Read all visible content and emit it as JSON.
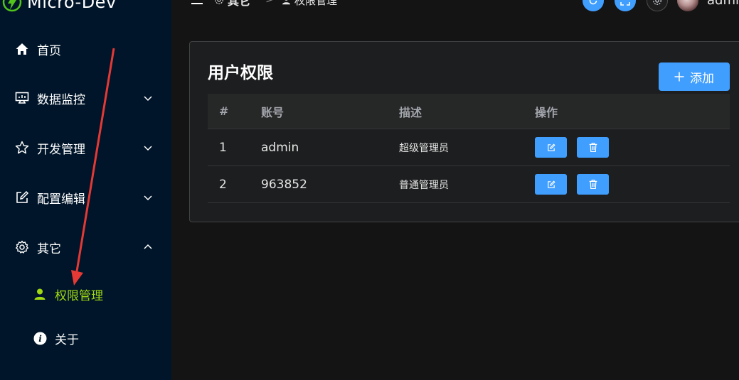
{
  "app": {
    "title": "Micro-Dev"
  },
  "sidebar": {
    "items": [
      {
        "label": "首页",
        "icon": "home-icon"
      },
      {
        "label": "数据监控",
        "icon": "monitor-icon"
      },
      {
        "label": "开发管理",
        "icon": "star-icon"
      },
      {
        "label": "配置编辑",
        "icon": "edit-icon"
      },
      {
        "label": "其它",
        "icon": "gear-icon"
      }
    ],
    "subitems": [
      {
        "label": "权限管理",
        "icon": "user-icon",
        "active": true
      },
      {
        "label": "关于",
        "icon": "info-icon"
      }
    ]
  },
  "header": {
    "breadcrumb": [
      "其它",
      "权限管理"
    ],
    "username": "admin"
  },
  "card": {
    "title": "用户权限",
    "add_label": "添加"
  },
  "table": {
    "columns": [
      "#",
      "账号",
      "描述",
      "操作"
    ],
    "rows": [
      {
        "num": "1",
        "account": "admin",
        "desc": "超级管理员"
      },
      {
        "num": "2",
        "account": "963852",
        "desc": "普通管理员"
      }
    ]
  },
  "colors": {
    "sidebar_bg": "#001529",
    "accent": "#409eff",
    "active": "#a0d911",
    "annotation": "#e53935"
  }
}
